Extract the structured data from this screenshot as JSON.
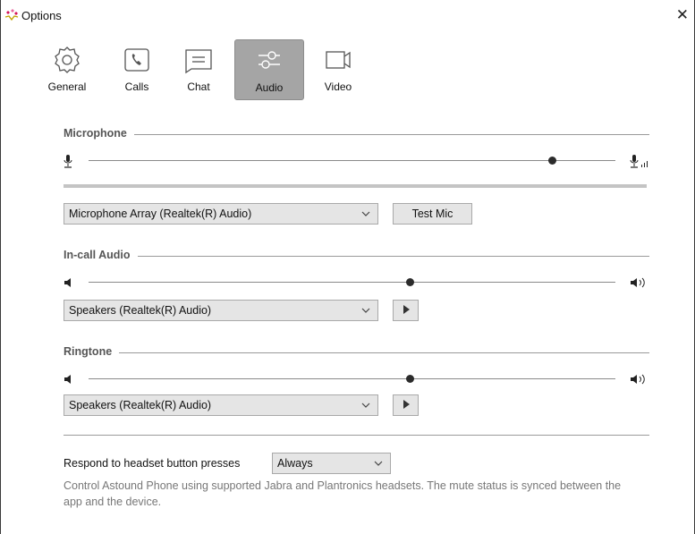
{
  "window": {
    "title": "Options",
    "close_glyph": "✕"
  },
  "tabs": [
    {
      "label": "General",
      "icon": "gear-icon"
    },
    {
      "label": "Calls",
      "icon": "phone-icon"
    },
    {
      "label": "Chat",
      "icon": "chat-icon"
    },
    {
      "label": "Audio",
      "icon": "audio-mixer-icon",
      "active": true
    },
    {
      "label": "Video",
      "icon": "video-camera-icon"
    }
  ],
  "microphone": {
    "label": "Microphone",
    "level_fraction": 0.88,
    "device": "Microphone Array (Realtek(R) Audio)",
    "test_label": "Test Mic"
  },
  "incall": {
    "label": "In-call Audio",
    "level_fraction": 0.61,
    "device": "Speakers (Realtek(R) Audio)"
  },
  "ringtone": {
    "label": "Ringtone",
    "level_fraction": 0.61,
    "device": "Speakers (Realtek(R) Audio)"
  },
  "headset": {
    "label": "Respond to headset button presses",
    "value": "Always",
    "hint": "Control Astound Phone using supported Jabra and Plantronics headsets. The mute status is synced between the app and the device."
  },
  "colors": {
    "active_tab": "#a5a5a5",
    "control_bg": "#e5e5e5",
    "section_text": "#555555",
    "hint_text": "#777777"
  }
}
